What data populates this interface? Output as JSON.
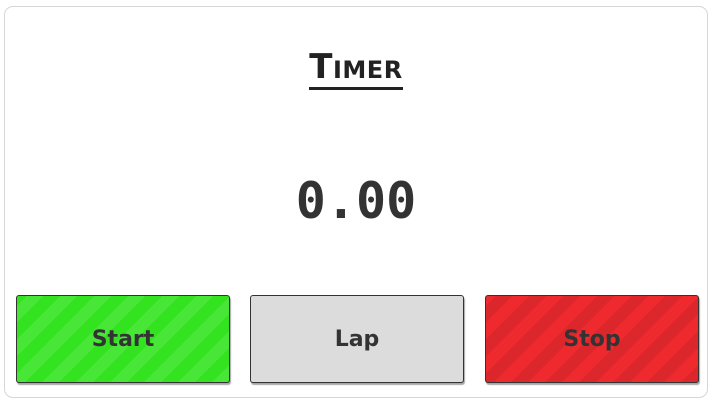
{
  "timer": {
    "title": "Timer",
    "display_value": "0.00"
  },
  "controls": {
    "start_label": "Start",
    "lap_label": "Lap",
    "stop_label": "Stop"
  },
  "colors": {
    "start": "#33e31f",
    "lap": "#dcdcdc",
    "stop": "#ee2a2f",
    "text": "#333333"
  }
}
